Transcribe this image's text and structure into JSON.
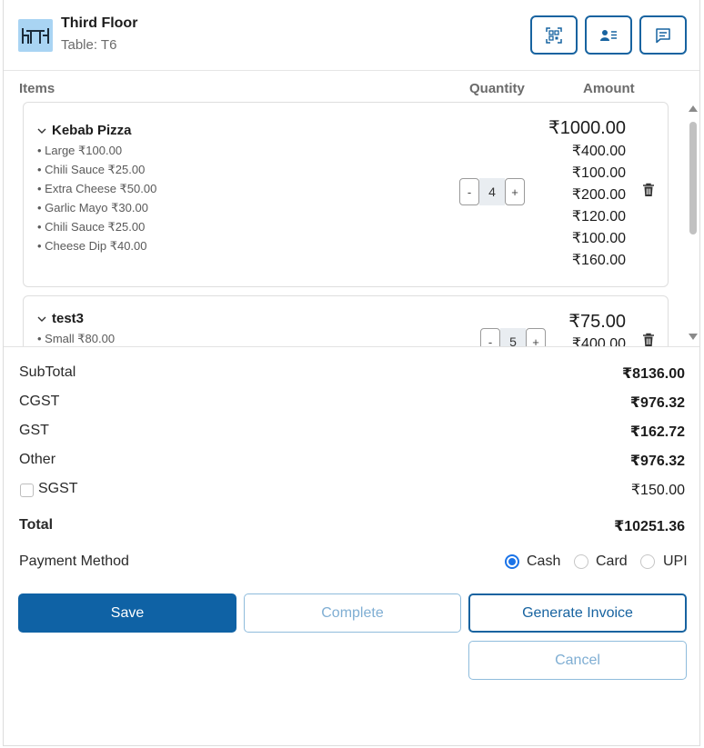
{
  "header": {
    "floor": "Third Floor",
    "table": "Table: T6",
    "icons": [
      "qr-code-icon",
      "customer-card-icon",
      "chat-icon"
    ]
  },
  "columns": {
    "items": "Items",
    "quantity": "Quantity",
    "amount": "Amount"
  },
  "items": [
    {
      "name": "Kebab Pizza",
      "quantity": "4",
      "amount": "₹1000.00",
      "addons": [
        {
          "label": "• Large ₹100.00",
          "amount": "₹400.00"
        },
        {
          "label": "• Chili Sauce ₹25.00",
          "amount": "₹100.00"
        },
        {
          "label": "• Extra Cheese ₹50.00",
          "amount": "₹200.00"
        },
        {
          "label": "• Garlic Mayo ₹30.00",
          "amount": "₹120.00"
        },
        {
          "label": "• Chili Sauce ₹25.00",
          "amount": "₹100.00"
        },
        {
          "label": "• Cheese Dip ₹40.00",
          "amount": "₹160.00"
        }
      ]
    },
    {
      "name": "test3",
      "quantity": "5",
      "amount": "₹75.00",
      "addons": [
        {
          "label": "• Small ₹80.00",
          "amount": "₹400.00"
        }
      ]
    }
  ],
  "summary": {
    "subtotal_label": "SubTotal",
    "subtotal": "₹8136.00",
    "cgst_label": "CGST",
    "cgst": "₹976.32",
    "gst_label": "GST",
    "gst": "₹162.72",
    "other_label": "Other",
    "other": "₹976.32",
    "sgst_label": "SGST",
    "sgst": "₹150.00",
    "total_label": "Total",
    "total": "₹10251.36"
  },
  "payment": {
    "label": "Payment Method",
    "options": [
      "Cash",
      "Card",
      "UPI"
    ],
    "selected": "Cash"
  },
  "buttons": {
    "save": "Save",
    "complete": "Complete",
    "invoice": "Generate Invoice",
    "cancel": "Cancel"
  },
  "colors": {
    "primary": "#0f62a5",
    "accent_light": "#8fbcdc",
    "table_icon_bg": "#a9d4f3",
    "radio": "#1a73e8"
  }
}
